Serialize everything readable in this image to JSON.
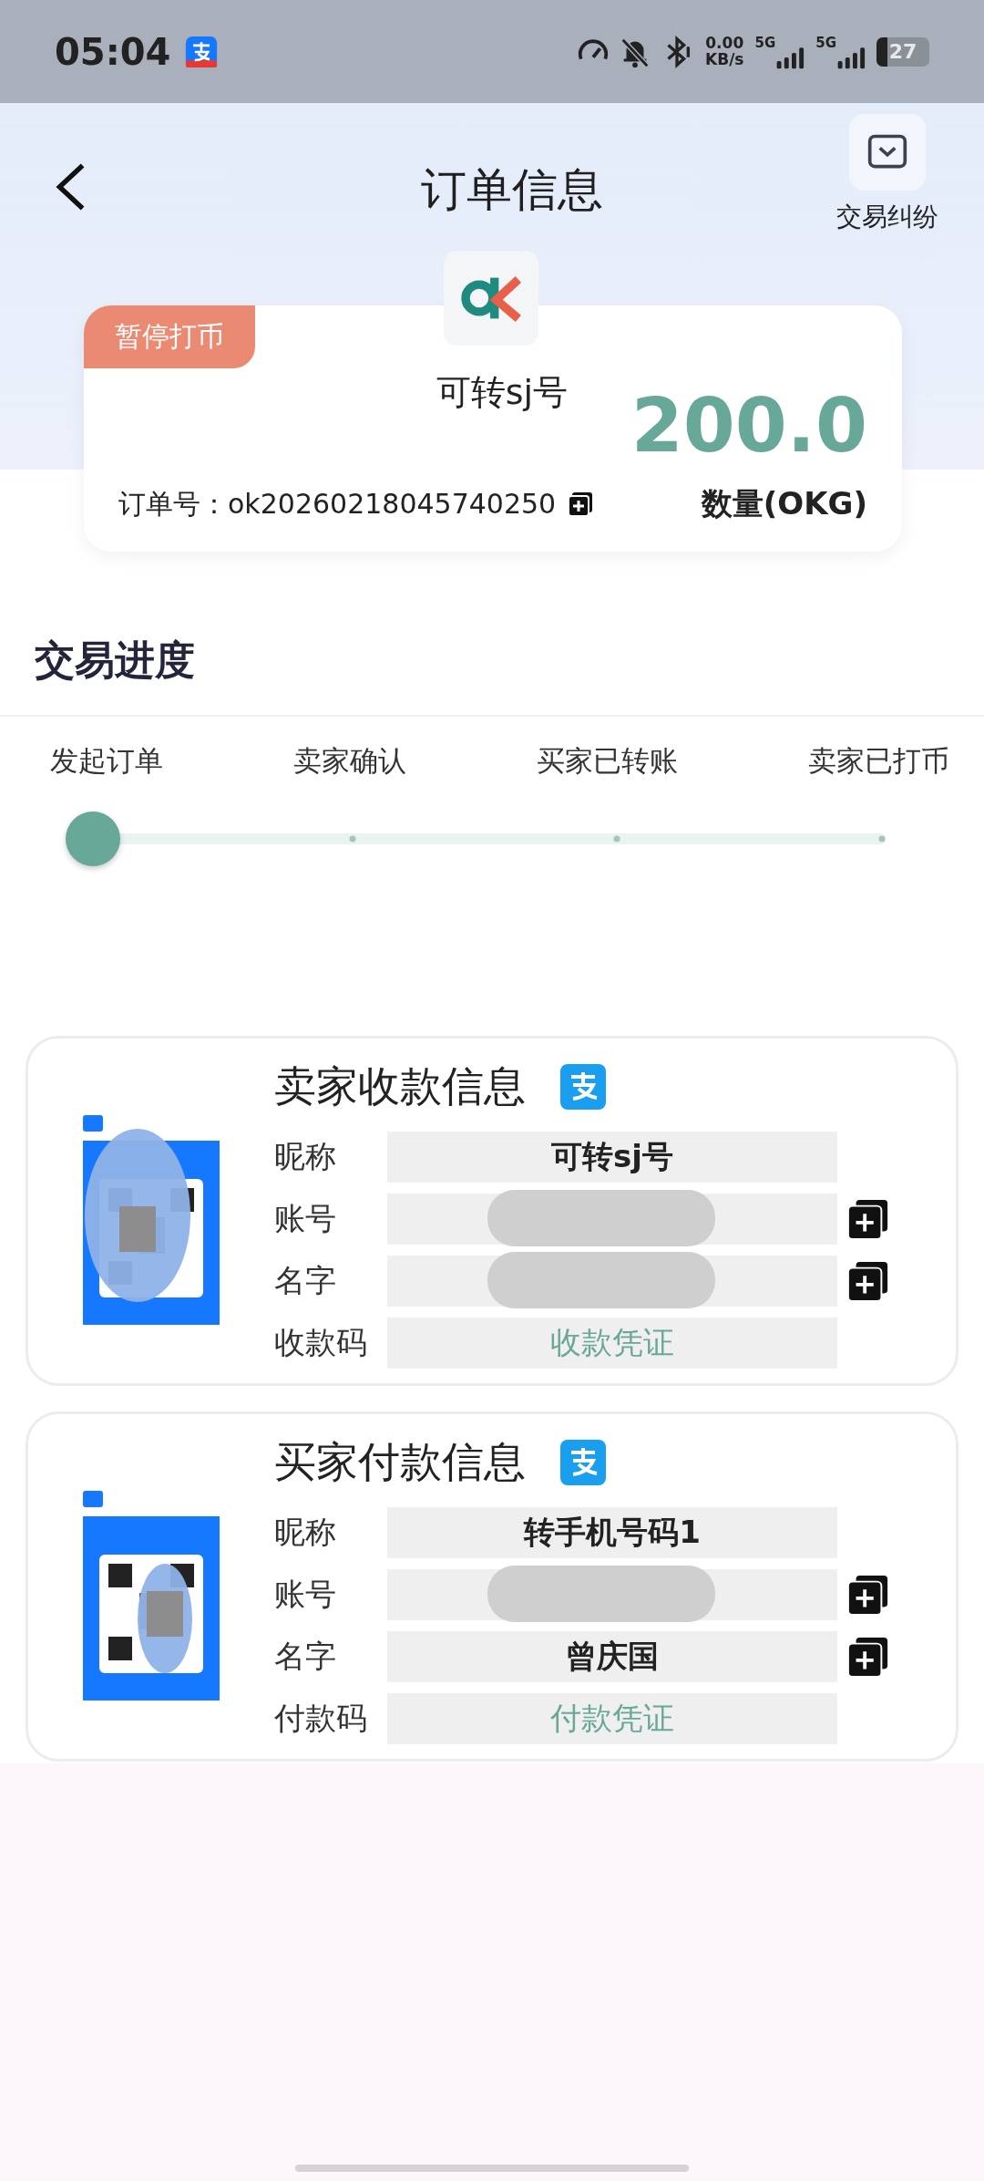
{
  "status_bar": {
    "time": "05:04",
    "net_speed": "0.00",
    "net_unit": "KB/s",
    "signals": [
      "5G",
      "5G"
    ],
    "battery": "27"
  },
  "header": {
    "title": "订单信息",
    "dispute_label": "交易纠纷"
  },
  "order": {
    "badge": "暂停打币",
    "name": "可转sj号",
    "amount": "200.0",
    "order_no": "订单号：ok20260218045740250",
    "amount_label": "数量(OKG)"
  },
  "progress": {
    "title": "交易进度",
    "steps": [
      {
        "label": "发起订单",
        "done": true
      },
      {
        "label": "卖家确认",
        "done": false
      },
      {
        "label": "买家已转账",
        "done": false
      },
      {
        "label": "卖家已打币",
        "done": false
      }
    ]
  },
  "cards": [
    {
      "title": "卖家收款信息",
      "rows": [
        {
          "label": "昵称",
          "kind": "text",
          "value": "可转sj号",
          "copyable": false
        },
        {
          "label": "账号",
          "kind": "hidden",
          "copyable": true
        },
        {
          "label": "名字",
          "kind": "hidden",
          "copyable": true
        },
        {
          "label": "收款码",
          "kind": "link",
          "value": "收款凭证",
          "copyable": false
        }
      ]
    },
    {
      "title": "买家付款信息",
      "rows": [
        {
          "label": "昵称",
          "kind": "text",
          "value": "转手机号码1",
          "copyable": false
        },
        {
          "label": "账号",
          "kind": "hidden",
          "copyable": true
        },
        {
          "label": "名字",
          "kind": "text",
          "value": "曾庆国",
          "copyable": true
        },
        {
          "label": "付款码",
          "kind": "link",
          "value": "付款凭证",
          "copyable": false
        }
      ]
    }
  ]
}
